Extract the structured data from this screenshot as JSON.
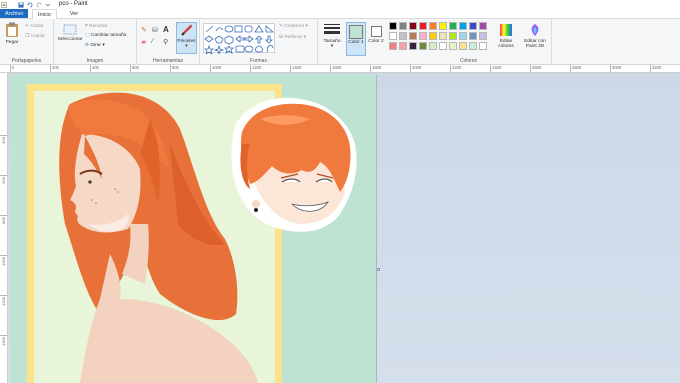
{
  "window": {
    "title": "pco - Paint"
  },
  "tabs": [
    "Archivo",
    "Inicio",
    "Ver"
  ],
  "ribbon": {
    "clipboard": {
      "paste": "Pegar",
      "cut": "Cortar",
      "copy": "Copiar",
      "label": "Portapapeles"
    },
    "image": {
      "select": "Seleccionar",
      "crop": "Recortar",
      "resize": "Cambiar tamaño",
      "rotate": "Girar",
      "label": "Imagen"
    },
    "tools": {
      "label": "Herramientas",
      "brushes": "Pinceles"
    },
    "shapes": {
      "outline": "Contorno",
      "fill": "Rellenar",
      "label": "Formas"
    },
    "size": {
      "label": "Tamaño"
    },
    "color1": "Color 1",
    "color2": "Color 2",
    "colors": {
      "label": "Colores",
      "edit": "Editar colores",
      "paint3d": "Editar con Paint 3D",
      "palette": [
        "#000000",
        "#7f7f7f",
        "#880015",
        "#ed1c24",
        "#ff7f27",
        "#fff200",
        "#22b14c",
        "#00a2e8",
        "#3f48cc",
        "#a349a4",
        "#ffffff",
        "#c3c3c3",
        "#b97a57",
        "#ffaec9",
        "#ffc90e",
        "#efe4b0",
        "#b5e61d",
        "#99d9ea",
        "#7092be",
        "#c8bfe7",
        "#f27e82",
        "#f5a3a6",
        "#3a1f3d",
        "#6e8b3d",
        "#d7ecc0",
        "#ffffff",
        "#e8f3c8",
        "#fbe38a",
        "#c9edd8",
        "#ffffff"
      ]
    }
  },
  "ruler": {
    "top": [
      "0",
      "200",
      "400",
      "600",
      "800",
      "1000",
      "1200",
      "1400",
      "1600",
      "1800",
      "2000",
      "2200",
      "2400",
      "2600",
      "2800",
      "3000",
      "3200"
    ],
    "left": [
      "400",
      "600",
      "800",
      "1000",
      "1200",
      "1400"
    ]
  },
  "accent": "#1e6bbf"
}
